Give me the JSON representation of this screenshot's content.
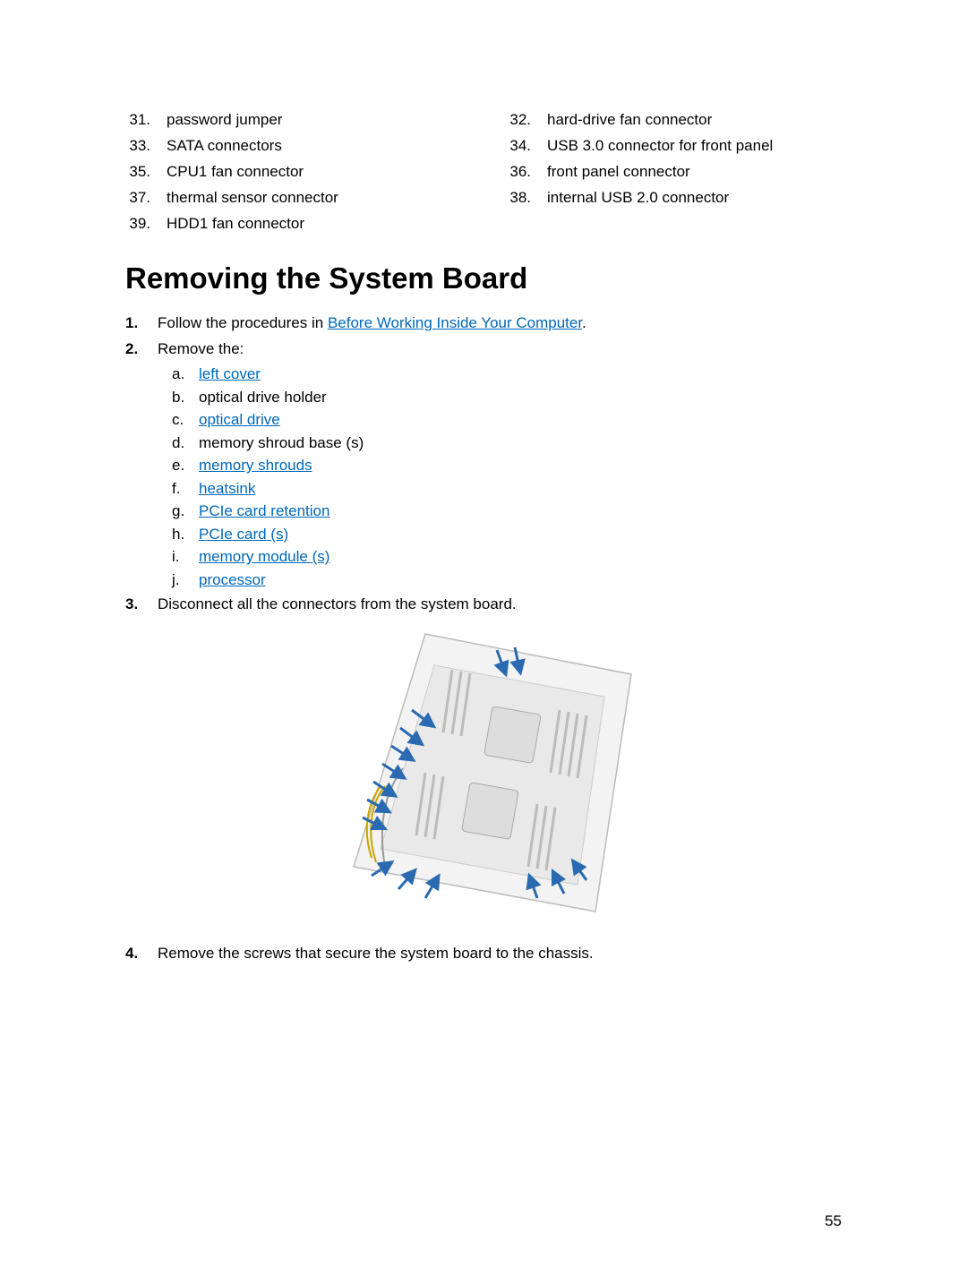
{
  "callouts": [
    {
      "num": "31.",
      "text": "password jumper"
    },
    {
      "num": "32.",
      "text": "hard-drive fan connector"
    },
    {
      "num": "33.",
      "text": "SATA connectors"
    },
    {
      "num": "34.",
      "text": "USB 3.0 connector for front panel"
    },
    {
      "num": "35.",
      "text": "CPU1 fan connector"
    },
    {
      "num": "36.",
      "text": "front panel connector"
    },
    {
      "num": "37.",
      "text": "thermal sensor connector"
    },
    {
      "num": "38.",
      "text": "internal USB 2.0 connector"
    },
    {
      "num": "39.",
      "text": "HDD1 fan connector"
    }
  ],
  "heading": "Removing the System Board",
  "step1": {
    "num": "1.",
    "prefix": "Follow the procedures in ",
    "link": "Before Working Inside Your Computer",
    "suffix": "."
  },
  "step2": {
    "num": "2.",
    "text": "Remove the:",
    "subs": [
      {
        "letter": "a.",
        "link": "left cover",
        "plain": ""
      },
      {
        "letter": "b.",
        "link": "",
        "plain": "optical drive holder"
      },
      {
        "letter": "c.",
        "link": "optical drive",
        "plain": ""
      },
      {
        "letter": "d.",
        "link": "",
        "plain": "memory shroud base (s)"
      },
      {
        "letter": "e.",
        "link": "memory shrouds",
        "plain": ""
      },
      {
        "letter": "f.",
        "link": "heatsink",
        "plain": ""
      },
      {
        "letter": "g.",
        "link": "PCIe card retention",
        "plain": ""
      },
      {
        "letter": "h.",
        "link": "PCIe card (s)",
        "plain": ""
      },
      {
        "letter": "i.",
        "link": "memory module (s)",
        "plain": ""
      },
      {
        "letter": "j.",
        "link": "processor",
        "plain": ""
      }
    ]
  },
  "step3": {
    "num": "3.",
    "text": "Disconnect all the connectors from the system board."
  },
  "step4": {
    "num": "4.",
    "text": "Remove the screws that secure the system board to the chassis."
  },
  "pageNumber": "55"
}
